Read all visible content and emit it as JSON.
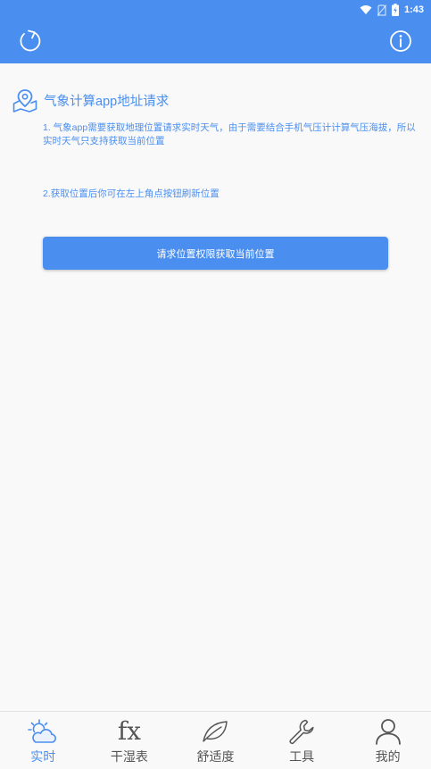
{
  "status_bar": {
    "time": "1:43",
    "icons": [
      "wifi-icon",
      "no-sim-icon",
      "battery-charging-icon"
    ]
  },
  "toolbar": {
    "left_icon": "refresh-icon",
    "right_icon": "info-icon",
    "color": "#4a8ff0"
  },
  "content": {
    "title": "气象计算app地址请求",
    "title_icon": "map-pin-icon",
    "desc1": "1. 气象app需要获取地理位置请求实时天气，由于需要结合手机气压计计算气压海拔，所以实时天气只支持获取当前位置",
    "desc2": "2.获取位置后你可在左上角点按钮刷新位置",
    "button_label": "请求位置权限获取当前位置"
  },
  "bottom_nav": {
    "items": [
      {
        "label": "实时",
        "icon": "weather-cloud-sun-icon",
        "active": true
      },
      {
        "label": "干湿表",
        "icon": "fx-icon",
        "active": false
      },
      {
        "label": "舒适度",
        "icon": "leaf-icon",
        "active": false
      },
      {
        "label": "工具",
        "icon": "wrench-icon",
        "active": false
      },
      {
        "label": "我的",
        "icon": "user-icon",
        "active": false
      }
    ],
    "active_color": "#4a8ff0"
  }
}
